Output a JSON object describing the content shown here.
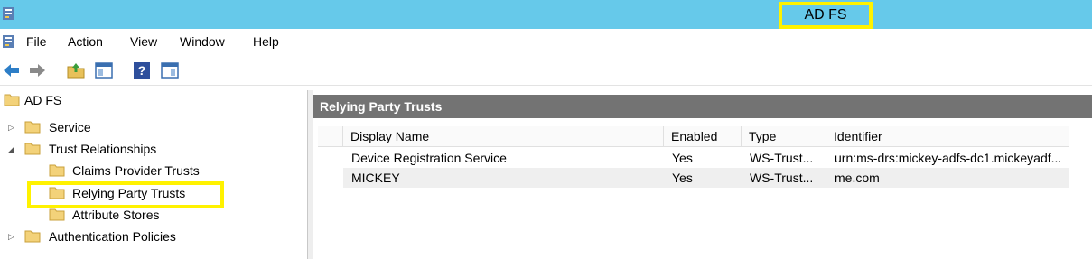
{
  "window": {
    "title": "AD FS"
  },
  "menu": [
    "File",
    "Action",
    "View",
    "Window",
    "Help"
  ],
  "toolbar": {
    "icons": [
      "back-arrow-icon",
      "forward-arrow-icon",
      "up-folder-icon",
      "show-hide-tree-icon",
      "help-icon",
      "show-hide-action-pane-icon"
    ]
  },
  "tree": {
    "root": "AD FS",
    "items": [
      {
        "label": "Service",
        "expander": "▷"
      },
      {
        "label": "Trust Relationships",
        "expander": "◢"
      },
      {
        "label": "Claims Provider Trusts"
      },
      {
        "label": "Relying Party Trusts",
        "selected": true
      },
      {
        "label": "Attribute Stores"
      },
      {
        "label": "Authentication Policies",
        "expander": "▷"
      }
    ]
  },
  "pane": {
    "title": "Relying Party Trusts",
    "columns": [
      "Display Name",
      "Enabled",
      "Type",
      "Identifier"
    ],
    "rows": [
      {
        "name": "Device Registration Service",
        "enabled": "Yes",
        "type": "WS-Trust...",
        "identifier": "urn:ms-drs:mickey-adfs-dc1.mickeyadf..."
      },
      {
        "name": "MICKEY",
        "enabled": "Yes",
        "type": "WS-Trust...",
        "identifier": "me.com"
      }
    ]
  },
  "colors": {
    "titlebar": "#66c9ea",
    "highlight": "#fff200",
    "pane_header": "#737373"
  }
}
